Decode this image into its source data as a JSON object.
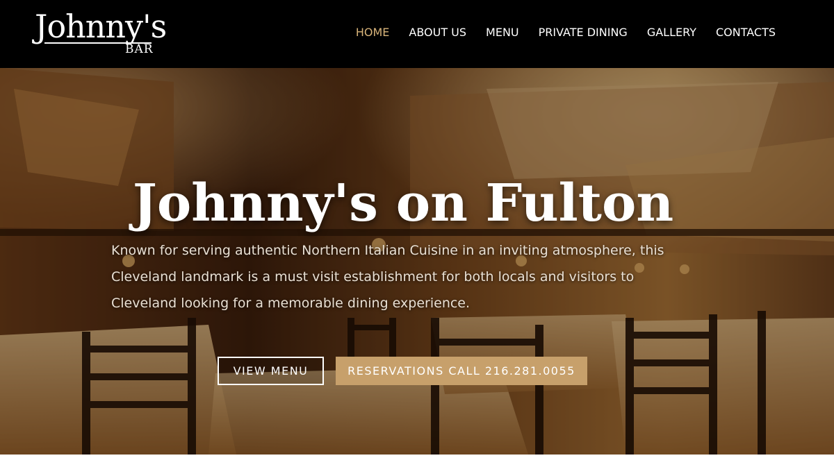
{
  "logo": {
    "main": "Johnny's",
    "sub": "BAR"
  },
  "nav": {
    "items": [
      {
        "label": "HOME",
        "active": true
      },
      {
        "label": "ABOUT US",
        "active": false
      },
      {
        "label": "MENU",
        "active": false
      },
      {
        "label": "PRIVATE DINING",
        "active": false
      },
      {
        "label": "GALLERY",
        "active": false
      },
      {
        "label": "CONTACTS",
        "active": false
      }
    ]
  },
  "hero": {
    "title": "Johnny's on Fulton",
    "description": "Known for serving authentic Northern Italian Cuisine in an inviting atmosphere, this Cleveland landmark is a must visit establishment for both locals and visitors to Cleveland looking for a memorable dining experience.",
    "buttons": {
      "menu": "VIEW MENU",
      "reserve": "RESERVATIONS CALL 216.281.0055"
    }
  },
  "colors": {
    "nav_background": "#000000",
    "active_link": "#d8b47a",
    "accent_button": "#c7a06b"
  }
}
